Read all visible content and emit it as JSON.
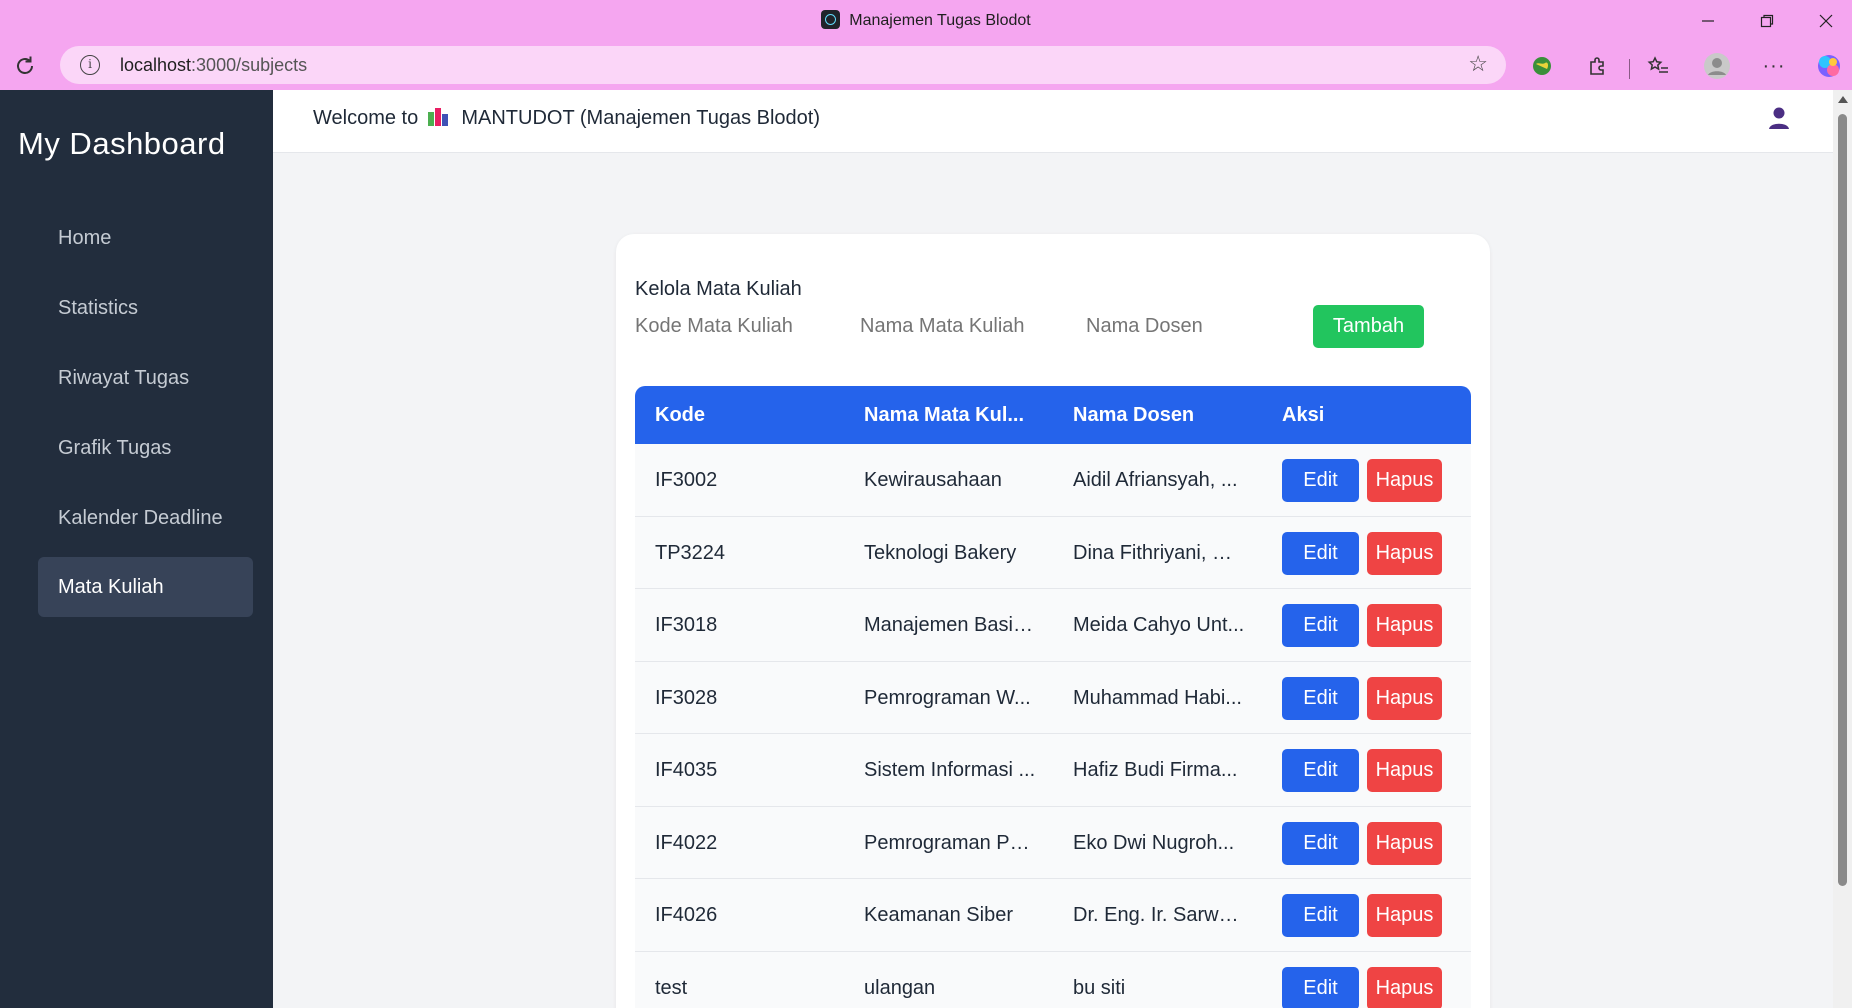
{
  "browser": {
    "tab_title": "Manajemen Tugas Blodot",
    "url_host": "localhost",
    "url_path": ":3000/subjects"
  },
  "sidebar": {
    "brand": "My Dashboard",
    "items": [
      {
        "label": "Home"
      },
      {
        "label": "Statistics"
      },
      {
        "label": "Riwayat Tugas"
      },
      {
        "label": "Grafik Tugas"
      },
      {
        "label": "Kalender Deadline"
      },
      {
        "label": "Mata Kuliah",
        "active": true
      }
    ]
  },
  "header": {
    "welcome_prefix": "Welcome to",
    "app_name": "MANTUDOT (Manajemen Tugas Blodot)"
  },
  "form": {
    "title": "Kelola Mata Kuliah",
    "kode_placeholder": "Kode Mata Kuliah",
    "nama_placeholder": "Nama Mata Kuliah",
    "dosen_placeholder": "Nama Dosen",
    "add_label": "Tambah"
  },
  "table": {
    "columns": [
      "Kode",
      "Nama Mata Kul...",
      "Nama Dosen",
      "Aksi"
    ],
    "edit_label": "Edit",
    "delete_label": "Hapus",
    "rows": [
      {
        "kode": "IF3002",
        "nama": "Kewirausahaan",
        "dosen": "Aidil Afriansyah, ..."
      },
      {
        "kode": "TP3224",
        "nama": "Teknologi Bakery",
        "dosen": "Dina Fithriyani, S...."
      },
      {
        "kode": "IF3018",
        "nama": "Manajemen Basis...",
        "dosen": "Meida Cahyo Unt..."
      },
      {
        "kode": "IF3028",
        "nama": "Pemrograman W...",
        "dosen": "Muhammad Habi..."
      },
      {
        "kode": "IF4035",
        "nama": "Sistem Informasi ...",
        "dosen": "Hafiz Budi Firma..."
      },
      {
        "kode": "IF4022",
        "nama": "Pemrograman Pa...",
        "dosen": "Eko Dwi Nugroh..."
      },
      {
        "kode": "IF4026",
        "nama": "Keamanan Siber",
        "dosen": "Dr. Eng. Ir. Sarwo..."
      },
      {
        "kode": "test",
        "nama": "ulangan",
        "dosen": "bu siti"
      }
    ]
  },
  "colors": {
    "browser_frame": "#f5a6f0",
    "sidebar": "#222d3d",
    "primary": "#2563eb",
    "success": "#22c55e",
    "danger": "#ef4444"
  }
}
